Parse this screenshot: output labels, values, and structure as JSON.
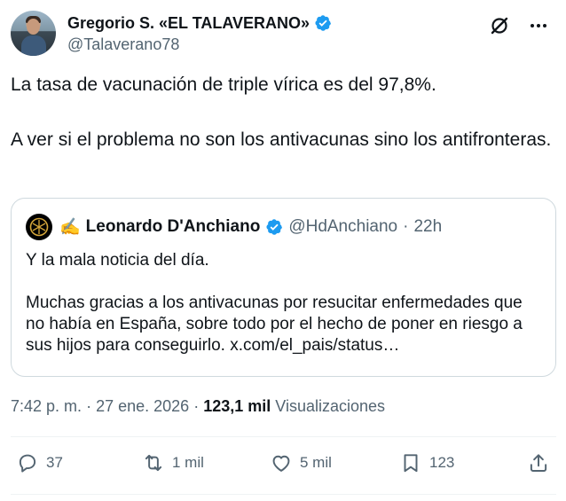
{
  "author": {
    "display_name": "Gregorio S. «EL TALAVERANO»",
    "handle": "@Talaveranо78"
  },
  "tweet": {
    "paragraphs": [
      "La tasa de vacunación de triple vírica es del 97,8%.",
      "A ver si el problema no son los antivacunas sino los antifronteras."
    ]
  },
  "quote": {
    "emoji": "✍️",
    "display_name": "Leonardo D'Anchiano",
    "handle": "@HdAnchiano",
    "dot": "·",
    "time": "22h",
    "paragraphs": [
      "Y la mala noticia del día.",
      "Muchas gracias a los antivacunas por resucitar enfermedades que no había en España, sobre todo por el hecho de poner en riesgo a sus hijos para conseguirlo. x.com/el_pais/status…"
    ]
  },
  "meta": {
    "time": "7:42 p. m.",
    "sep1": "·",
    "date": "27 ene. 2026",
    "sep2": "·",
    "views_count": "123,1 mil",
    "views_label": "Visualizaciones"
  },
  "actions": {
    "replies": "37",
    "reposts": "1 mil",
    "likes": "5 mil",
    "bookmarks": "123"
  },
  "icons": {
    "verified_color": "#1d9bf0",
    "verified": "verified-badge-icon",
    "grok": "grok-icon",
    "more": "more-icon",
    "reply": "reply-icon",
    "repost": "repost-icon",
    "like": "like-icon",
    "bookmark": "bookmark-icon",
    "share": "share-icon"
  }
}
